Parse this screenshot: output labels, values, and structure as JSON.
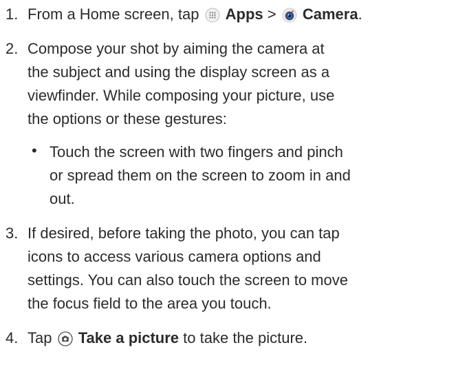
{
  "steps": [
    {
      "number": "1.",
      "pre_text": "From a Home screen, tap ",
      "apps_label": "Apps",
      "separator": " > ",
      "camera_label": "Camera",
      "post_text": "."
    },
    {
      "number": "2.",
      "lines": [
        "Compose your shot by aiming the camera at",
        "the subject and using the display screen as a",
        "viewfinder. While composing your picture, use",
        "the options or these gestures:"
      ],
      "bullet": {
        "marker": "•",
        "lines": [
          "Touch the screen with two fingers and pinch",
          "or spread them on the screen to zoom in and",
          "out."
        ]
      }
    },
    {
      "number": "3.",
      "lines": [
        "If desired, before taking the photo, you can tap",
        "icons to access various camera options and",
        "settings. You can also touch the screen to move",
        "the focus field to the area you touch."
      ]
    },
    {
      "number": "4.",
      "pre_text": "Tap ",
      "take_picture_label": "Take a picture",
      "post_text": " to take the picture."
    }
  ],
  "icons": {
    "apps": "apps-grid-icon",
    "camera": "camera-app-icon",
    "shutter": "shutter-icon"
  }
}
